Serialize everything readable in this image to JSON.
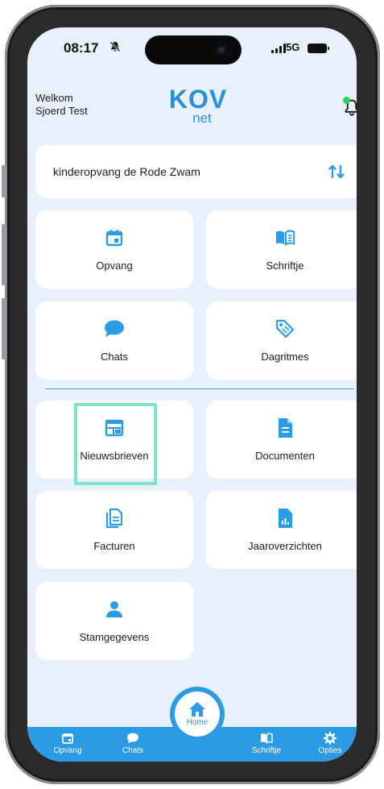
{
  "status_bar": {
    "time": "08:17",
    "network": "5G"
  },
  "header": {
    "welcome": "Welkom",
    "user_name": "Sjoerd Test",
    "logo_main": "KOV",
    "logo_sub": "net"
  },
  "facility": {
    "name": "kinderopvang de Rode Zwam"
  },
  "tiles": [
    {
      "label": "Opvang",
      "icon": "calendar-icon"
    },
    {
      "label": "Schriftje",
      "icon": "book-icon"
    },
    {
      "label": "Chats",
      "icon": "chat-icon"
    },
    {
      "label": "Dagritmes",
      "icon": "tags-icon"
    },
    {
      "label": "Nieuwsbrieven",
      "icon": "newspaper-icon"
    },
    {
      "label": "Documenten",
      "icon": "document-icon"
    },
    {
      "label": "Facturen",
      "icon": "invoices-icon"
    },
    {
      "label": "Jaaroverzichten",
      "icon": "report-icon"
    },
    {
      "label": "Stamgegevens",
      "icon": "person-icon"
    }
  ],
  "bottom_nav": {
    "items": [
      {
        "label": "Opvang",
        "icon": "calendar-icon"
      },
      {
        "label": "Chats",
        "icon": "chat-icon"
      },
      {
        "label": "Home",
        "icon": "home-icon"
      },
      {
        "label": "Schriftje",
        "icon": "book-icon"
      },
      {
        "label": "Opties",
        "icon": "gear-icon"
      }
    ]
  },
  "colors": {
    "accent": "#2c9be5",
    "background": "#e8f0fc",
    "highlight": "#7fe3c6",
    "notification_dot": "#2fd05a"
  }
}
